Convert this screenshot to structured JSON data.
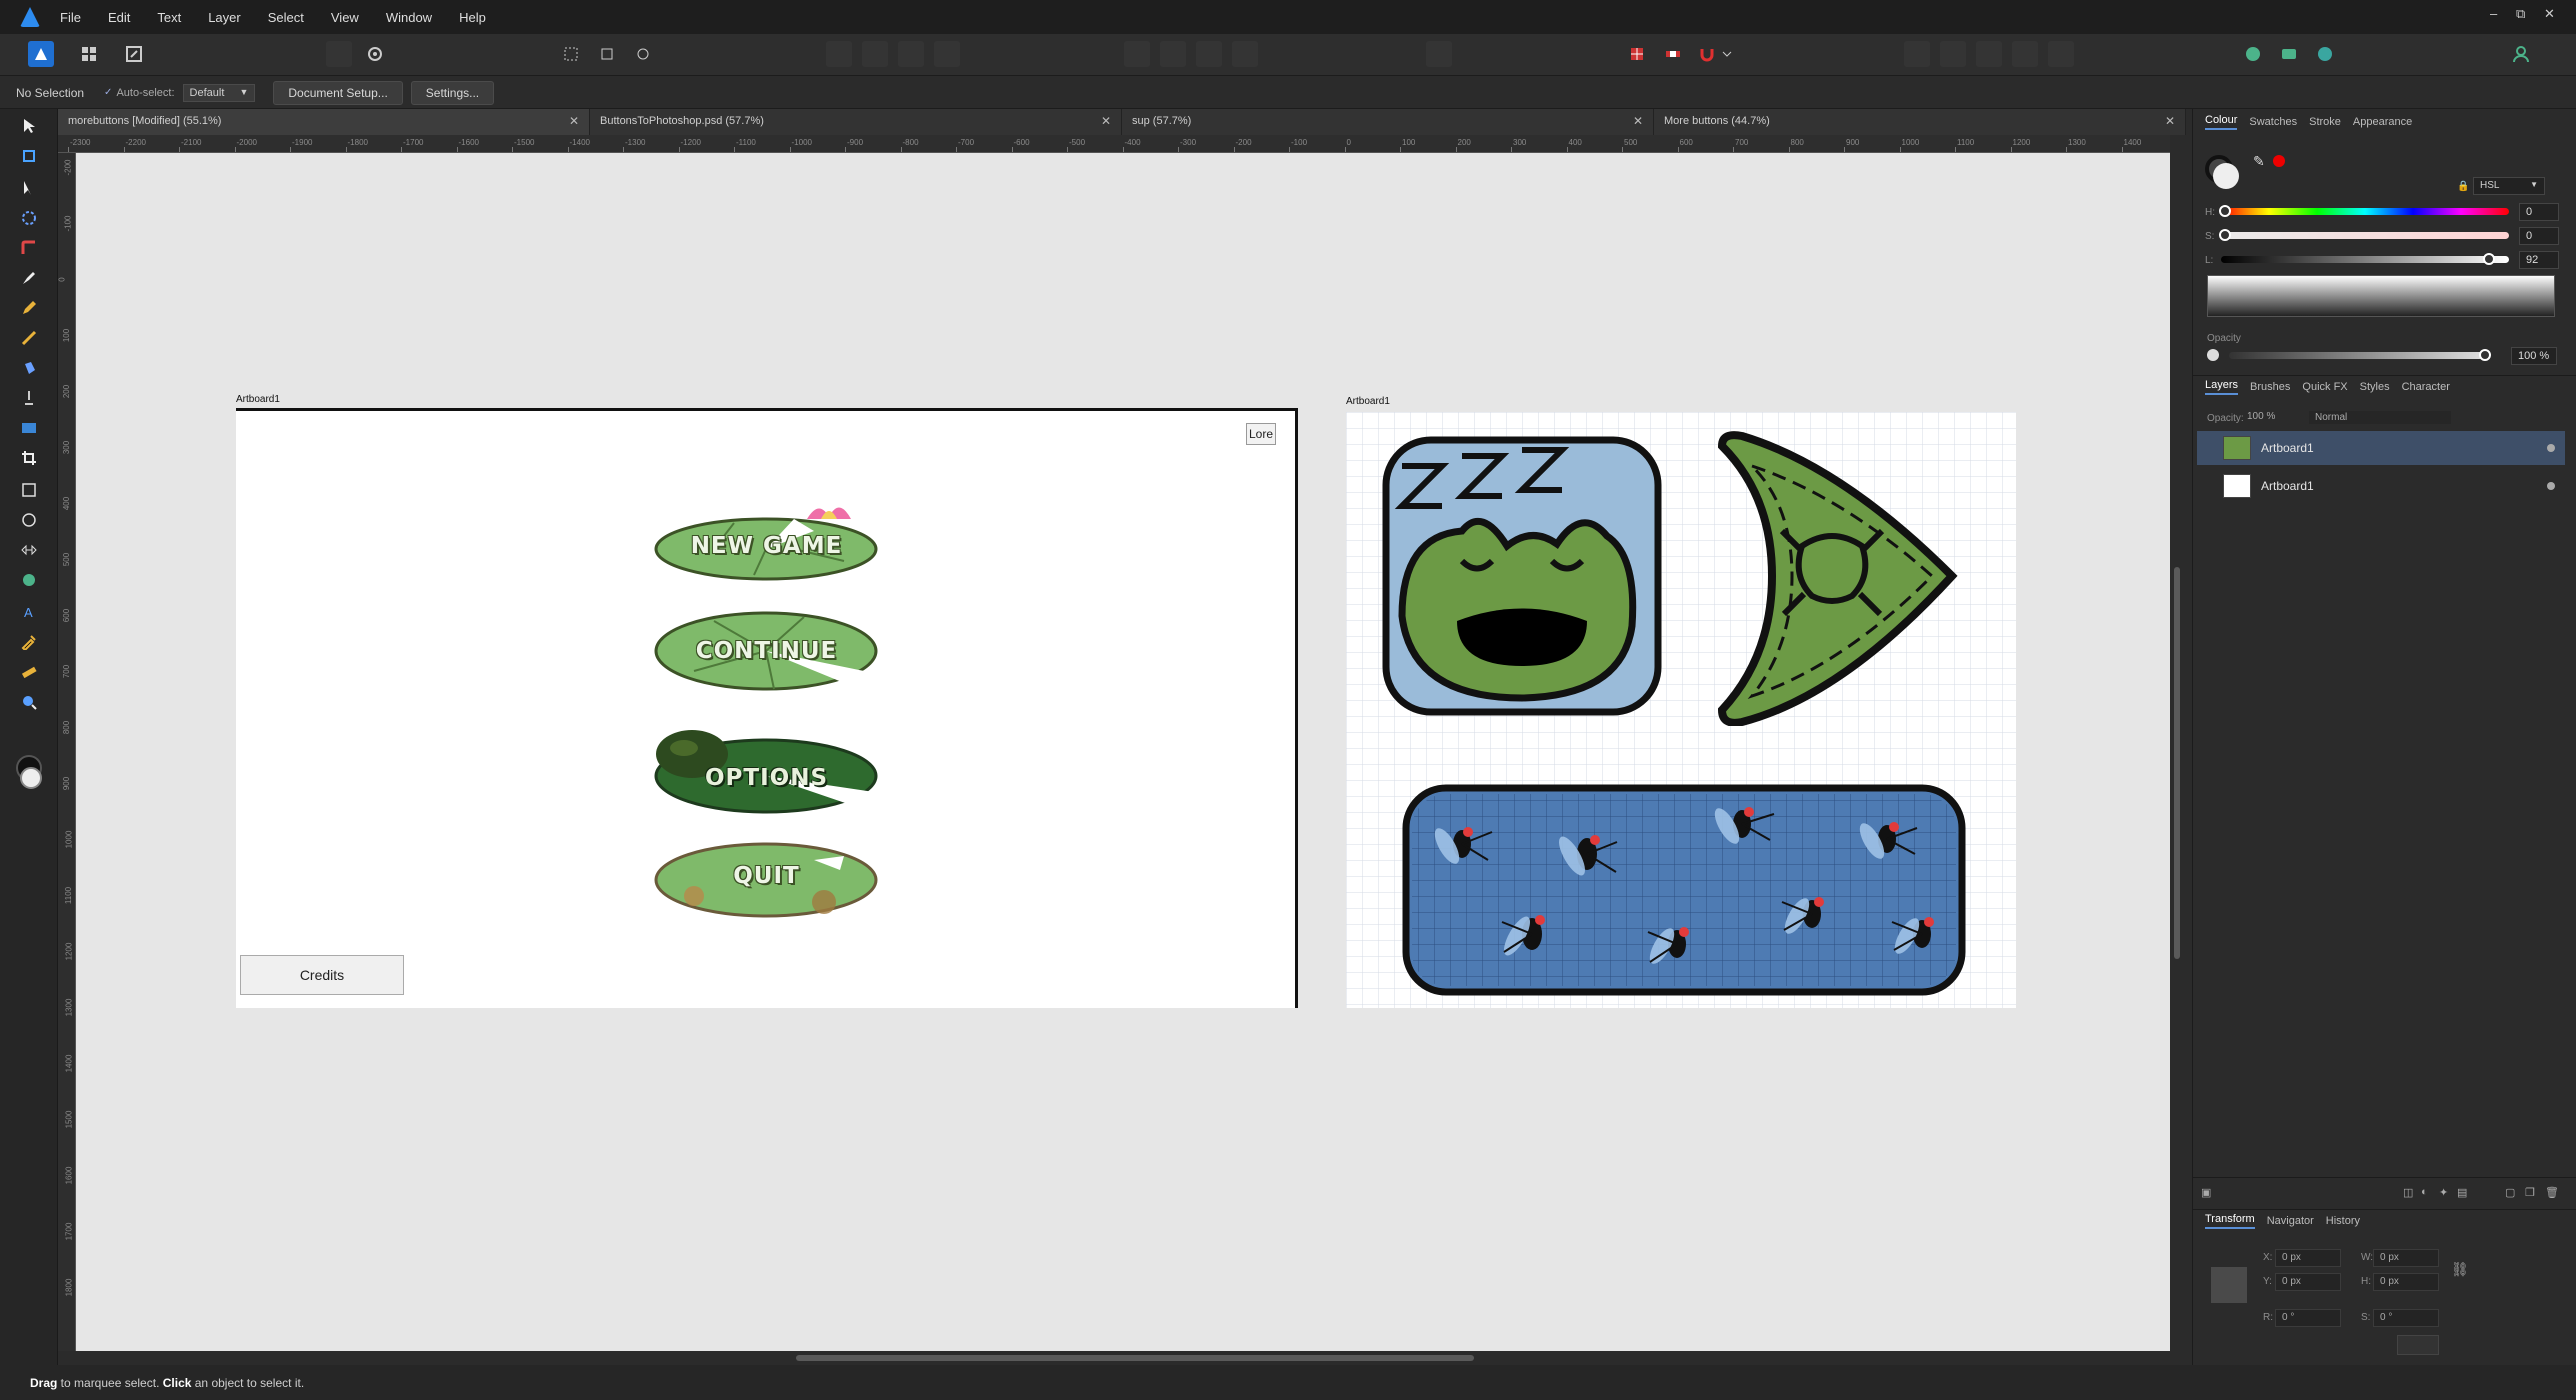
{
  "app": {
    "window_controls": {
      "minimize": "–",
      "restore": "⧉",
      "close": "✕"
    }
  },
  "menu": [
    "File",
    "Edit",
    "Text",
    "Layer",
    "Select",
    "View",
    "Window",
    "Help"
  ],
  "context_bar": {
    "selection": "No Selection",
    "auto_select_label": "Auto-select:",
    "auto_select_value": "Default",
    "document_setup": "Document Setup...",
    "settings": "Settings..."
  },
  "tabs": [
    {
      "label": "morebuttons [Modified] (55.1%)",
      "close": "✕"
    },
    {
      "label": "ButtonsToPhotoshop.psd (57.7%)",
      "close": "✕"
    },
    {
      "label": "sup (57.7%)",
      "close": "✕"
    },
    {
      "label": "More buttons (44.7%)",
      "close": "✕"
    }
  ],
  "ruler_top": [
    "-2300",
    "-2200",
    "-2100",
    "-2000",
    "-1900",
    "-1800",
    "-1700",
    "-1600",
    "-1500",
    "-1400",
    "-1300",
    "-1200",
    "-1100",
    "-1000",
    "-900",
    "-800",
    "-700",
    "-600",
    "-500",
    "-400",
    "-300",
    "-200",
    "-100",
    "0",
    "100",
    "200",
    "300",
    "400",
    "500",
    "600",
    "700",
    "800",
    "900",
    "1000",
    "1100",
    "1200",
    "1300",
    "1400"
  ],
  "ruler_left": [
    "-200",
    "-100",
    "0",
    "100",
    "200",
    "300",
    "400",
    "500",
    "600",
    "700",
    "800",
    "900",
    "1000",
    "1100",
    "1200",
    "1300",
    "1400",
    "1500",
    "1600",
    "1700",
    "1800"
  ],
  "canvas": {
    "artboard1_label": "Artboard1",
    "artboard2_label": "Artboard1",
    "lore_button": "Lore",
    "credits_button": "Credits",
    "pads": [
      "NEW GAME",
      "CONTINUE",
      "OPTIONS",
      "QUIT"
    ],
    "frog_face_text": "ZZZ"
  },
  "panel": {
    "colour_tabs": [
      "Colour",
      "Swatches",
      "Stroke",
      "Appearance"
    ],
    "colour_model": "HSL",
    "h_label": "H:",
    "h_value": "0",
    "s_label": "S:",
    "s_value": "0",
    "l_label": "L:",
    "l_value": "92",
    "opacity_label": "Opacity",
    "opacity_value": "100 %",
    "layer_tabs": [
      "Layers",
      "Brushes",
      "Quick FX",
      "Styles",
      "Character"
    ],
    "layer_opacity_label": "Opacity:",
    "layer_opacity": "100 %",
    "blend_mode": "Normal",
    "layers": [
      "Artboard1",
      "Artboard1"
    ],
    "transform_tabs": [
      "Transform",
      "Navigator",
      "History"
    ],
    "x_label": "X:",
    "x": "0 px",
    "y_label": "Y:",
    "y": "0 px",
    "w_label": "W:",
    "w": "0 px",
    "h_label_t": "H:",
    "h": "0 px",
    "r_label": "R:",
    "r": "0 °",
    "s_label_t": "S:",
    "s": "0 °"
  },
  "status": {
    "drag": "Drag",
    "text1": " to marquee select. ",
    "click": "Click",
    "text2": " an object to select it."
  },
  "colors": {
    "accent": "#2d8cf0",
    "selection": "#3e4f68",
    "canvas": "#e6e6e6",
    "pad_light": "#7fba6a",
    "pad_dark": "#2e6a2e",
    "frog_green": "#6c9a45",
    "tile_blue": "#9abbd9"
  }
}
